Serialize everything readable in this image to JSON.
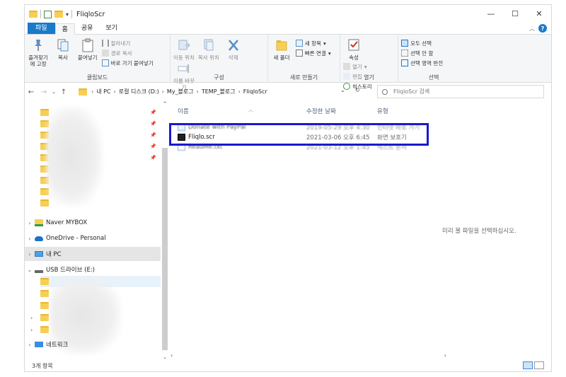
{
  "window": {
    "title": "FliqloScr",
    "controls": {
      "minimize": "—",
      "maximize": "☐",
      "close": "✕"
    }
  },
  "ribbon_tabs": {
    "file": "파일",
    "home": "홈",
    "share": "공유",
    "view": "보기"
  },
  "ribbon": {
    "clipboard": {
      "label": "클립보드",
      "pin": "즐겨찾기에 고정",
      "copy": "복사",
      "paste": "붙여넣기",
      "cut": "잘라내기",
      "copy_path": "경로 복사",
      "paste_shortcut": "바로 가기 붙여넣기"
    },
    "organize": {
      "label": "구성",
      "move_to": "이동 위치",
      "copy_to": "복사 위치",
      "delete": "삭제",
      "rename": "이름 바꾸기"
    },
    "new": {
      "label": "새로 만들기",
      "new_folder": "새 폴더",
      "new_item": "새 항목",
      "easy_access": "빠른 연결"
    },
    "open": {
      "label": "열기",
      "properties": "속성",
      "open": "열기",
      "edit": "편집",
      "history": "히스토리"
    },
    "select": {
      "label": "선택",
      "select_all": "모두 선택",
      "select_none": "선택 안 함",
      "invert": "선택 영역 반전"
    }
  },
  "address": {
    "breadcrumbs": [
      "내 PC",
      "로컬 디스크 (D:)",
      "My_블로그",
      "TEMP_블로그",
      "FliqloScr"
    ],
    "search_placeholder": "FliqloScr 검색"
  },
  "nav": {
    "naver": "Naver MYBOX",
    "onedrive": "OneDrive - Personal",
    "thispc": "내 PC",
    "usb": "USB 드라이브 (E:)",
    "network": "네트워크"
  },
  "columns": {
    "name": "이름",
    "modified": "수정한 날짜",
    "type": "유형"
  },
  "files": [
    {
      "name": "Donate with PayPal",
      "modified": "2019-05-29 오후 4:30",
      "type": "인터넷 바로 가기"
    },
    {
      "name": "Fliqlo.scr",
      "modified": "2021-03-06 오후 6:45",
      "type": "화면 보호기"
    },
    {
      "name": "ReadMe.txt",
      "modified": "2021-03-12 오후 1:45",
      "type": "텍스트 문서"
    }
  ],
  "preview_message": "미리 볼 파일을 선택하십시오.",
  "status": {
    "item_count": "3개 항목"
  },
  "colors": {
    "accent": "#1979ca",
    "highlight_box": "#1a1acd",
    "folder": "#f6cf53"
  }
}
